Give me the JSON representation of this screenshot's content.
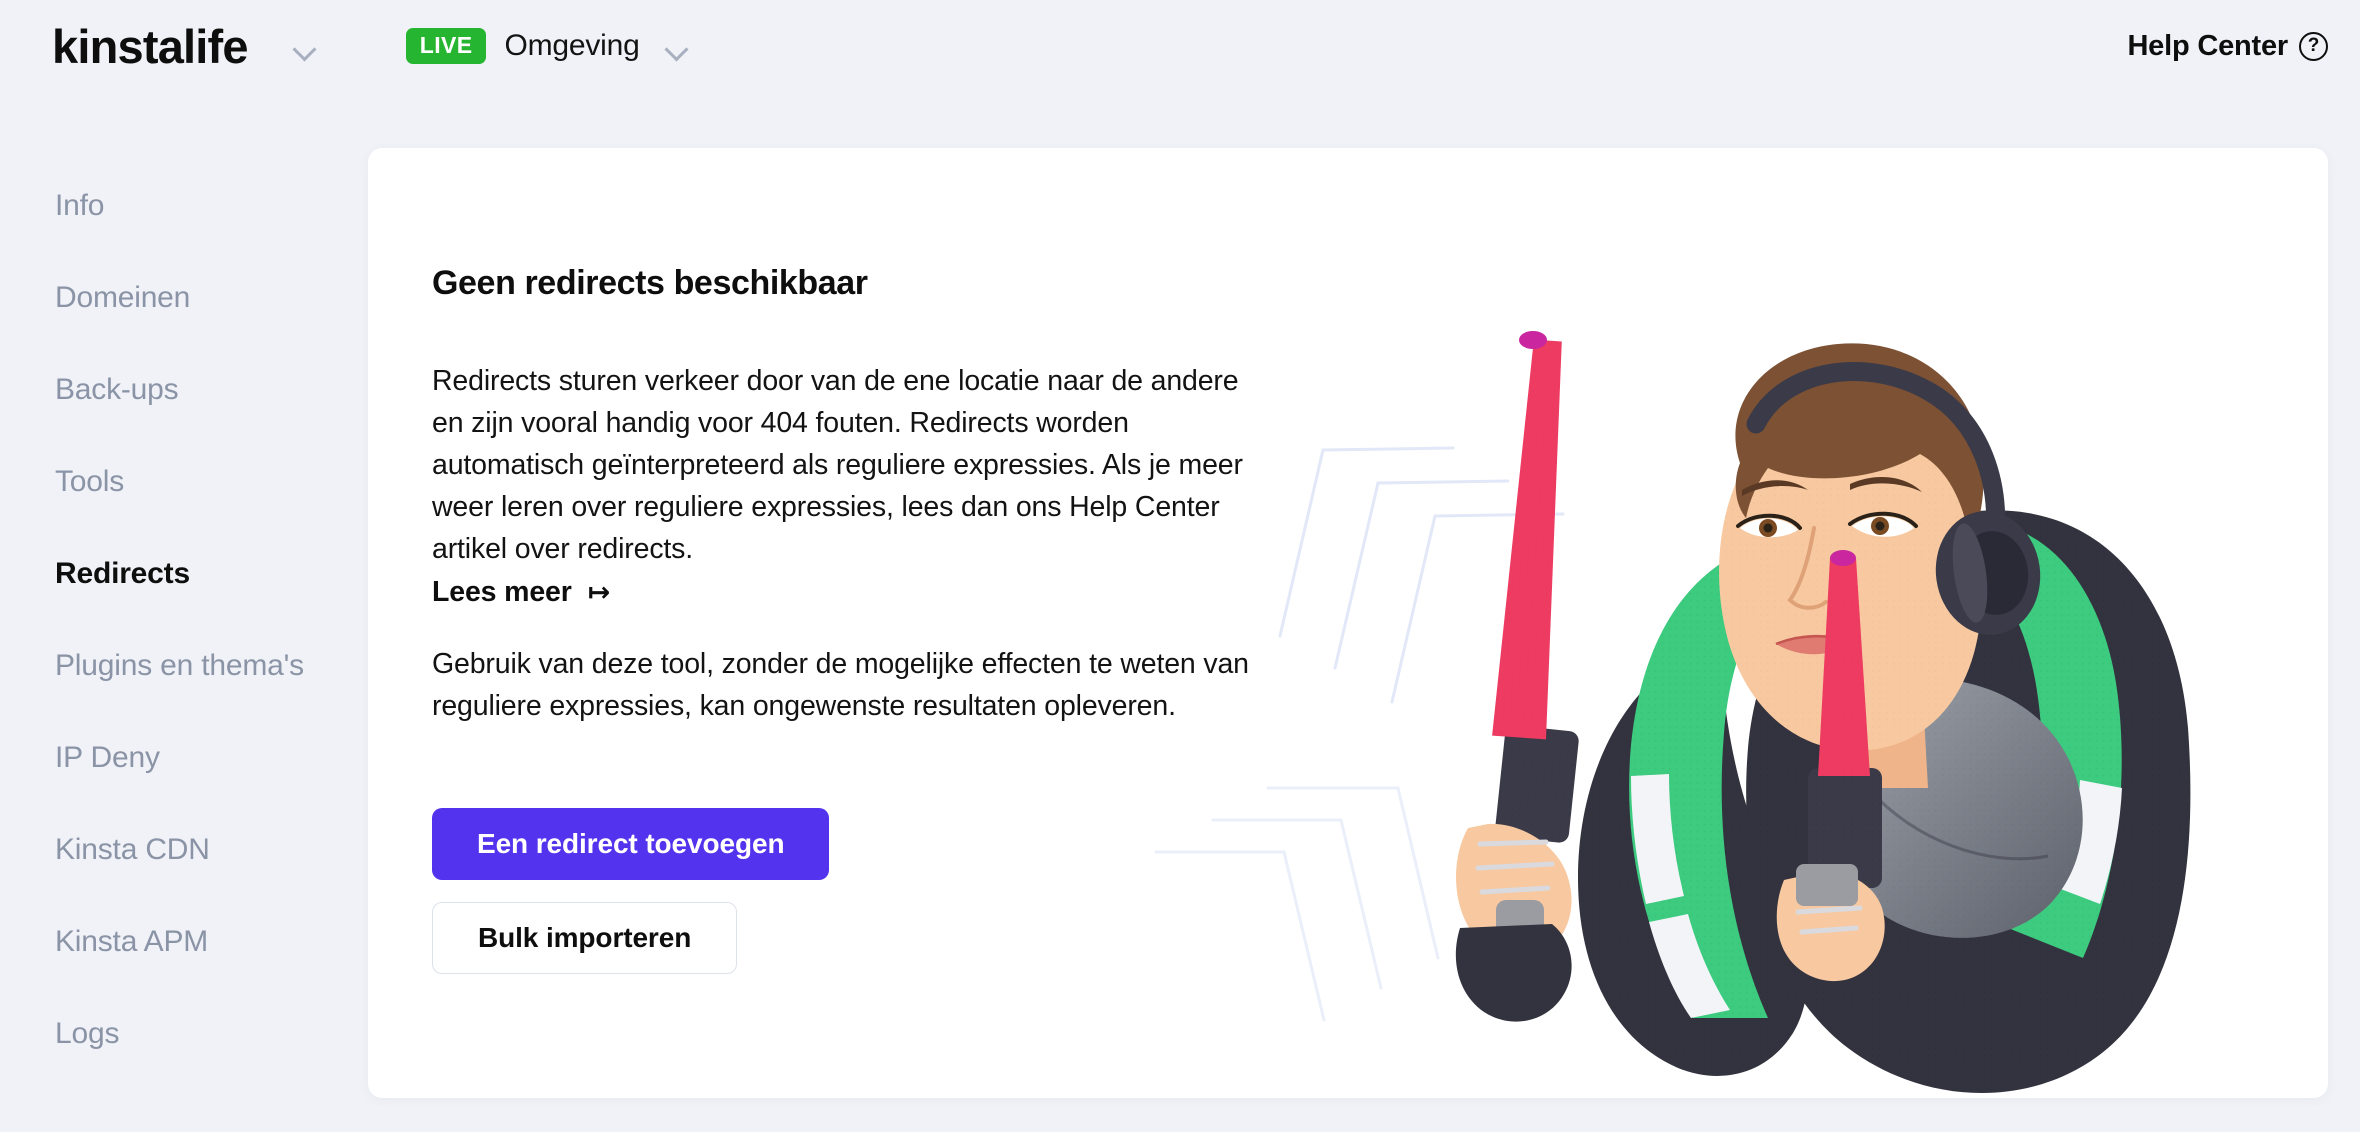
{
  "header": {
    "site_name": "kinstalife",
    "site_switch_icon": "chevron-down-icon",
    "env_badge": "LIVE",
    "env_label": "Omgeving",
    "env_switch_icon": "chevron-down-icon",
    "help_label": "Help Center",
    "help_icon": "question-circle-icon",
    "help_icon_glyph": "?"
  },
  "sidebar": {
    "items": [
      {
        "label": "Info",
        "active": false
      },
      {
        "label": "Domeinen",
        "active": false
      },
      {
        "label": "Back-ups",
        "active": false
      },
      {
        "label": "Tools",
        "active": false
      },
      {
        "label": "Redirects",
        "active": true
      },
      {
        "label": "Plugins en thema's",
        "active": false
      },
      {
        "label": "IP Deny",
        "active": false
      },
      {
        "label": "Kinsta CDN",
        "active": false
      },
      {
        "label": "Kinsta APM",
        "active": false
      },
      {
        "label": "Logs",
        "active": false
      }
    ]
  },
  "main": {
    "empty_title": "Geen redirects beschikbaar",
    "intro_paragraph": "Redirects sturen verkeer door van de ene locatie naar de andere en zijn vooral handig voor 404 fouten. Redirects worden automatisch geïnterpreteerd als reguliere expressies. Als je meer weer leren over reguliere expressies, lees dan ons Help Center artikel over redirects.",
    "read_more_label": "Lees meer",
    "read_more_icon": "arrow-right-bar-icon",
    "read_more_glyph": "↦",
    "warning_paragraph": "Gebruik van deze tool, zonder de mogelijke effecten te weten van reguliere expressies, kan ongewenste resultaten opleveren.",
    "primary_button_label": "Een redirect toevoegen",
    "secondary_button_label": "Bulk importeren",
    "illustration_name": "person-with-traffic-batons-illustration"
  },
  "colors": {
    "page_background": "#F0F2F7",
    "card_background": "#FFFFFF",
    "accent_purple": "#5333ED",
    "live_green": "#26B531",
    "muted_text": "#8A94A6",
    "body_text": "#131314",
    "heading_text": "#0E0E0E",
    "vest_green": "#3DCB7F",
    "baton_pink": "#EE3B61",
    "baton_magenta": "#C9269F",
    "jacket_dark": "#33333F",
    "skin": "#F8C9A0",
    "hair_brown": "#7C5134",
    "chevron_line": "#E2E8F7"
  }
}
